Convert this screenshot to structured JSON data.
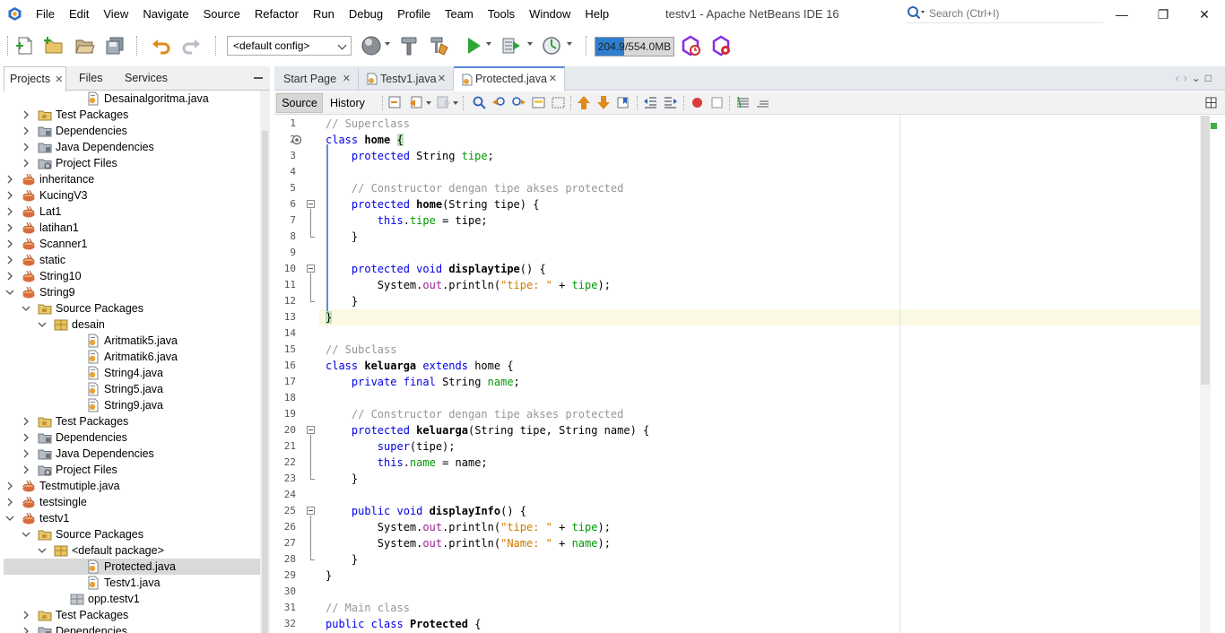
{
  "app": {
    "window_title": "testv1 - Apache NetBeans IDE 16",
    "menus": [
      "File",
      "Edit",
      "View",
      "Navigate",
      "Source",
      "Refactor",
      "Run",
      "Debug",
      "Profile",
      "Team",
      "Tools",
      "Window",
      "Help"
    ],
    "search_placeholder": "Search (Ctrl+I)",
    "window_buttons": {
      "minimize": "—",
      "maximize": "❐",
      "close": "✕"
    }
  },
  "toolbar": {
    "config": "<default config>",
    "memory_label": "204.9/554.0MB",
    "memory_fraction": 0.37,
    "icons": [
      "new-file-icon",
      "new-project-icon",
      "open-project-icon",
      "save-all-icon",
      "undo-icon",
      "redo-icon",
      "globe-icon",
      "hammer-icon",
      "clean-build-icon",
      "run-icon",
      "debug-icon",
      "profile-icon",
      "gc-icon",
      "gc-snapshot-icon"
    ]
  },
  "left_panel": {
    "tabs": [
      "Projects",
      "Files",
      "Services"
    ],
    "active_tab": "Projects",
    "tree": [
      {
        "label": "Desainalgoritma.java",
        "depth": 4,
        "type": "java",
        "arrow": "none"
      },
      {
        "label": "Test Packages",
        "depth": 1,
        "type": "package-folder",
        "arrow": "collapsed"
      },
      {
        "label": "Dependencies",
        "depth": 1,
        "type": "deps",
        "arrow": "collapsed"
      },
      {
        "label": "Java Dependencies",
        "depth": 1,
        "type": "deps",
        "arrow": "collapsed"
      },
      {
        "label": "Project Files",
        "depth": 1,
        "type": "project-files",
        "arrow": "collapsed"
      },
      {
        "label": "inheritance",
        "depth": 0,
        "type": "project",
        "arrow": "collapsed"
      },
      {
        "label": "KucingV3",
        "depth": 0,
        "type": "project",
        "arrow": "collapsed"
      },
      {
        "label": "Lat1",
        "depth": 0,
        "type": "project",
        "arrow": "collapsed"
      },
      {
        "label": "latihan1",
        "depth": 0,
        "type": "project",
        "arrow": "collapsed"
      },
      {
        "label": "Scanner1",
        "depth": 0,
        "type": "project",
        "arrow": "collapsed"
      },
      {
        "label": "static",
        "depth": 0,
        "type": "project",
        "arrow": "collapsed"
      },
      {
        "label": "String10",
        "depth": 0,
        "type": "project",
        "arrow": "collapsed"
      },
      {
        "label": "String9",
        "depth": 0,
        "type": "project",
        "arrow": "expanded"
      },
      {
        "label": "Source Packages",
        "depth": 1,
        "type": "package-folder",
        "arrow": "expanded"
      },
      {
        "label": "desain",
        "depth": 2,
        "type": "package",
        "arrow": "expanded"
      },
      {
        "label": "Aritmatik5.java",
        "depth": 4,
        "type": "java",
        "arrow": "none"
      },
      {
        "label": "Aritmatik6.java",
        "depth": 4,
        "type": "java",
        "arrow": "none"
      },
      {
        "label": "String4.java",
        "depth": 4,
        "type": "java",
        "arrow": "none"
      },
      {
        "label": "String5.java",
        "depth": 4,
        "type": "java",
        "arrow": "none"
      },
      {
        "label": "String9.java",
        "depth": 4,
        "type": "java",
        "arrow": "none"
      },
      {
        "label": "Test Packages",
        "depth": 1,
        "type": "package-folder",
        "arrow": "collapsed"
      },
      {
        "label": "Dependencies",
        "depth": 1,
        "type": "deps",
        "arrow": "collapsed"
      },
      {
        "label": "Java Dependencies",
        "depth": 1,
        "type": "deps",
        "arrow": "collapsed"
      },
      {
        "label": "Project Files",
        "depth": 1,
        "type": "project-files",
        "arrow": "collapsed"
      },
      {
        "label": "Testmutiple.java",
        "depth": 0,
        "type": "project",
        "arrow": "collapsed"
      },
      {
        "label": "testsingle",
        "depth": 0,
        "type": "project",
        "arrow": "collapsed"
      },
      {
        "label": "testv1",
        "depth": 0,
        "type": "project",
        "arrow": "expanded"
      },
      {
        "label": "Source Packages",
        "depth": 1,
        "type": "package-folder",
        "arrow": "expanded"
      },
      {
        "label": "<default package>",
        "depth": 2,
        "type": "package",
        "arrow": "expanded"
      },
      {
        "label": "Protected.java",
        "depth": 4,
        "type": "java",
        "arrow": "none",
        "selected": true
      },
      {
        "label": "Testv1.java",
        "depth": 4,
        "type": "java",
        "arrow": "none"
      },
      {
        "label": "opp.testv1",
        "depth": 3,
        "type": "package-gray",
        "arrow": "none"
      },
      {
        "label": "Test Packages",
        "depth": 1,
        "type": "package-folder",
        "arrow": "collapsed"
      },
      {
        "label": "Dependencies",
        "depth": 1,
        "type": "deps",
        "arrow": "collapsed"
      }
    ]
  },
  "editor": {
    "tabs": [
      {
        "label": "Start Page",
        "active": false,
        "icon": false
      },
      {
        "label": "Testv1.java",
        "active": false,
        "icon": true
      },
      {
        "label": "Protected.java",
        "active": true,
        "icon": true
      }
    ],
    "view_buttons": {
      "source": "Source",
      "history": "History"
    },
    "current_line": 13,
    "code": [
      {
        "n": "1",
        "t": [
          [
            "cm",
            "// Superclass"
          ]
        ]
      },
      {
        "n": "2",
        "t": [
          [
            "kw",
            "class"
          ],
          [
            "",
            " "
          ],
          [
            "b",
            "home"
          ],
          [
            "",
            " "
          ],
          [
            "brace",
            "{"
          ]
        ]
      },
      {
        "n": "3",
        "t": [
          [
            "",
            "    "
          ],
          [
            "kw",
            "protected"
          ],
          [
            "",
            " String "
          ],
          [
            "fd",
            "tipe"
          ],
          [
            "",
            ";"
          ]
        ]
      },
      {
        "n": "4",
        "t": []
      },
      {
        "n": "5",
        "t": [
          [
            "",
            "    "
          ],
          [
            "cm",
            "// Constructor dengan tipe akses protected"
          ]
        ]
      },
      {
        "n": "6",
        "t": [
          [
            "",
            "    "
          ],
          [
            "kw",
            "protected"
          ],
          [
            "",
            " "
          ],
          [
            "b",
            "home"
          ],
          [
            "",
            "(String tipe) {"
          ]
        ]
      },
      {
        "n": "7",
        "t": [
          [
            "",
            "        "
          ],
          [
            "kw",
            "this"
          ],
          [
            "",
            "."
          ],
          [
            "fd",
            "tipe"
          ],
          [
            "",
            " = tipe;"
          ]
        ]
      },
      {
        "n": "8",
        "t": [
          [
            "",
            "    }"
          ]
        ]
      },
      {
        "n": "9",
        "t": []
      },
      {
        "n": "10",
        "t": [
          [
            "",
            "    "
          ],
          [
            "kw",
            "protected"
          ],
          [
            "",
            " "
          ],
          [
            "kw",
            "void"
          ],
          [
            "",
            " "
          ],
          [
            "b",
            "displaytipe"
          ],
          [
            "",
            "() {"
          ]
        ]
      },
      {
        "n": "11",
        "t": [
          [
            "",
            "        System."
          ],
          [
            "fd2",
            "out"
          ],
          [
            "",
            ".println("
          ],
          [
            "str",
            "\"tipe: \""
          ],
          [
            "",
            " + "
          ],
          [
            "fd",
            "tipe"
          ],
          [
            "",
            ");"
          ]
        ]
      },
      {
        "n": "12",
        "t": [
          [
            "",
            "    }"
          ]
        ]
      },
      {
        "n": "13",
        "t": [
          [
            "brace",
            "}"
          ]
        ]
      },
      {
        "n": "14",
        "t": []
      },
      {
        "n": "15",
        "t": [
          [
            "cm",
            "// Subclass"
          ]
        ]
      },
      {
        "n": "16",
        "t": [
          [
            "kw",
            "class"
          ],
          [
            "",
            " "
          ],
          [
            "b",
            "keluarga"
          ],
          [
            "",
            " "
          ],
          [
            "kw",
            "extends"
          ],
          [
            "",
            " home {"
          ]
        ]
      },
      {
        "n": "17",
        "t": [
          [
            "",
            "    "
          ],
          [
            "kw",
            "private"
          ],
          [
            "",
            " "
          ],
          [
            "kw",
            "final"
          ],
          [
            "",
            " String "
          ],
          [
            "fd",
            "name"
          ],
          [
            "",
            ";"
          ]
        ]
      },
      {
        "n": "18",
        "t": []
      },
      {
        "n": "19",
        "t": [
          [
            "",
            "    "
          ],
          [
            "cm",
            "// Constructor dengan tipe akses protected"
          ]
        ]
      },
      {
        "n": "20",
        "t": [
          [
            "",
            "    "
          ],
          [
            "kw",
            "protected"
          ],
          [
            "",
            " "
          ],
          [
            "b",
            "keluarga"
          ],
          [
            "",
            "(String tipe, String name) {"
          ]
        ]
      },
      {
        "n": "21",
        "t": [
          [
            "",
            "        "
          ],
          [
            "kw",
            "super"
          ],
          [
            "",
            "(tipe);"
          ]
        ]
      },
      {
        "n": "22",
        "t": [
          [
            "",
            "        "
          ],
          [
            "kw",
            "this"
          ],
          [
            "",
            "."
          ],
          [
            "fd",
            "name"
          ],
          [
            "",
            " = name;"
          ]
        ]
      },
      {
        "n": "23",
        "t": [
          [
            "",
            "    }"
          ]
        ]
      },
      {
        "n": "24",
        "t": []
      },
      {
        "n": "25",
        "t": [
          [
            "",
            "    "
          ],
          [
            "kw",
            "public"
          ],
          [
            "",
            " "
          ],
          [
            "kw",
            "void"
          ],
          [
            "",
            " "
          ],
          [
            "b",
            "displayInfo"
          ],
          [
            "",
            "() {"
          ]
        ]
      },
      {
        "n": "26",
        "t": [
          [
            "",
            "        System."
          ],
          [
            "fd2",
            "out"
          ],
          [
            "",
            ".println("
          ],
          [
            "str",
            "\"tipe: \""
          ],
          [
            "",
            " + "
          ],
          [
            "fd",
            "tipe"
          ],
          [
            "",
            ");"
          ]
        ]
      },
      {
        "n": "27",
        "t": [
          [
            "",
            "        System."
          ],
          [
            "fd2",
            "out"
          ],
          [
            "",
            ".println("
          ],
          [
            "str",
            "\"Name: \""
          ],
          [
            "",
            " + "
          ],
          [
            "fd",
            "name"
          ],
          [
            "",
            ");"
          ]
        ]
      },
      {
        "n": "28",
        "t": [
          [
            "",
            "    }"
          ]
        ]
      },
      {
        "n": "29",
        "t": [
          [
            "",
            "}"
          ]
        ]
      },
      {
        "n": "30",
        "t": []
      },
      {
        "n": "31",
        "t": [
          [
            "cm",
            "// Main class"
          ]
        ]
      },
      {
        "n": "32",
        "t": [
          [
            "kw",
            "public"
          ],
          [
            "",
            " "
          ],
          [
            "kw",
            "class"
          ],
          [
            "",
            " "
          ],
          [
            "b",
            "Protected"
          ],
          [
            "",
            " {"
          ]
        ]
      }
    ]
  },
  "colors": {
    "keyword": "#0000e6",
    "comment": "#969696",
    "field": "#009900",
    "static_field": "#9b2393",
    "string": "#ce7b00",
    "current_line": "#fbf8e3",
    "selection": "#d9d9d9",
    "accent": "#5b8ad6"
  }
}
